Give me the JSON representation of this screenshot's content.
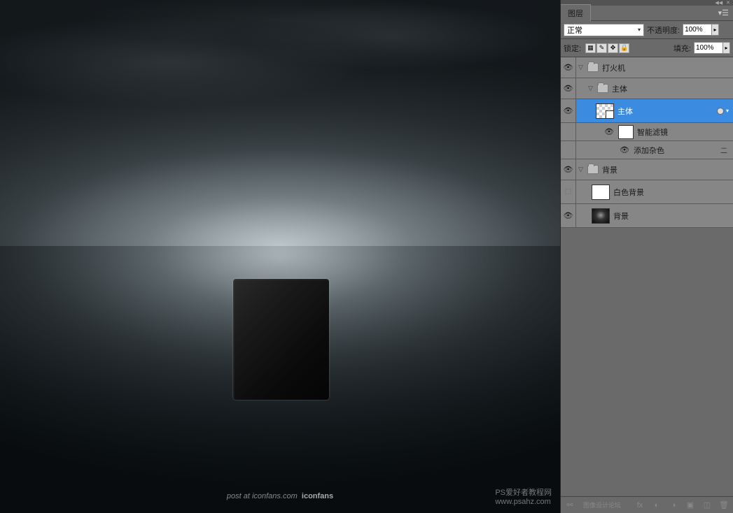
{
  "canvas": {
    "watermark_prefix": "post at ",
    "watermark_site": "iconfans",
    "watermark_suffix": ".com",
    "watermark_brand": "iconfans",
    "watermark_corner_label": "PS爱好者教程网",
    "watermark_corner_url": "www.psahz.com"
  },
  "panel": {
    "tab_label": "图层",
    "blend_mode": "正常",
    "opacity_label": "不透明度:",
    "opacity_value": "100%",
    "lock_label": "锁定:",
    "fill_label": "填充:",
    "fill_value": "100%"
  },
  "layers": {
    "group1": "打火机",
    "group1_sub": "主体",
    "selected_layer": "主体",
    "smart_filters_label": "智能滤镜",
    "filter1": "添加杂色",
    "group2": "背景",
    "layer_white_bg": "白色背景",
    "layer_bg": "背景"
  },
  "footer": {
    "text": "图像设计论坛"
  }
}
